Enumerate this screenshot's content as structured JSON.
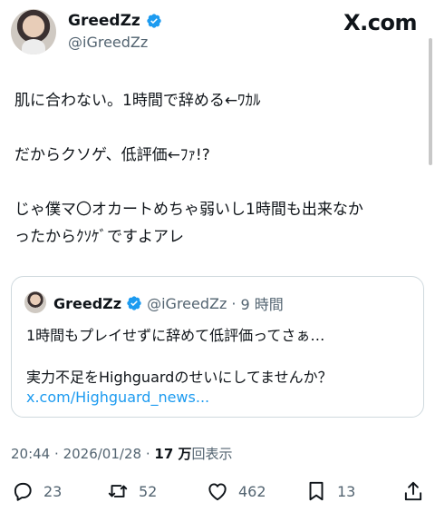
{
  "header": {
    "display_name": "GreedZz",
    "handle": "@iGreedZz",
    "brand": "X.com"
  },
  "post": {
    "lines": [
      "肌に合わない。1時間で辞める←ﾜｶﾙ",
      "",
      "だからクソゲ、低評価←ﾌｧ!?",
      "",
      "じゃ僕マ〇オカートめちゃ弱いし1時間も出来なか",
      "ったからｸｿｹﾞですよアレ"
    ]
  },
  "quote": {
    "display_name": "GreedZz",
    "handle": "@iGreedZz",
    "separator": "·",
    "time": "9 時間",
    "line1": "1時間もプレイせずに辞めて低評価ってさぁ…",
    "line2": "実力不足をHighguardのせいにしてませんか？",
    "link": "x.com/Highguard_news..."
  },
  "meta": {
    "time": "20:44",
    "separator1": "·",
    "date": "2026/01/28",
    "separator2": "·",
    "views_count": "17 万",
    "views_label": "回表示"
  },
  "actions": {
    "replies": "23",
    "reposts": "52",
    "likes": "462",
    "bookmarks": "13"
  },
  "colors": {
    "verified": "#1d9bf0",
    "link": "#1d9bf0",
    "secondary_text": "#536471"
  }
}
